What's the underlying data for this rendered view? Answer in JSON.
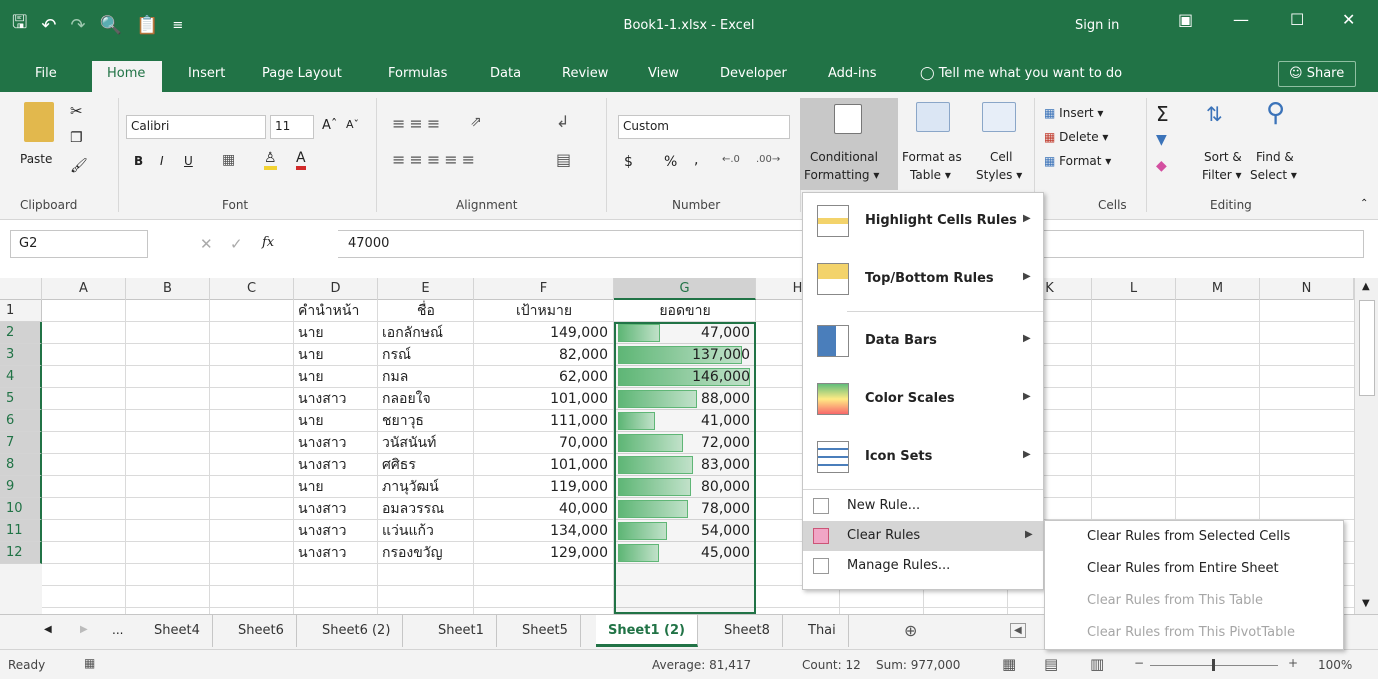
{
  "window": {
    "title": "Book1-1.xlsx - Excel",
    "sign_in": "Sign in",
    "qat_icons": [
      "save-icon",
      "undo-icon",
      "redo-icon",
      "print-preview-icon",
      "paste-icon",
      "customize-qat-icon"
    ]
  },
  "tabs": [
    "File",
    "Home",
    "Insert",
    "Page Layout",
    "Formulas",
    "Data",
    "Review",
    "View",
    "Developer",
    "Add-ins"
  ],
  "tell_me": "Tell me what you want to do",
  "share": "Share",
  "ribbon": {
    "clipboard": {
      "label": "Clipboard",
      "paste": "Paste"
    },
    "font": {
      "label": "Font",
      "name": "Calibri",
      "size": "11",
      "bold": "B",
      "italic": "I",
      "underline": "U"
    },
    "alignment": {
      "label": "Alignment"
    },
    "number": {
      "label": "Number",
      "format": "Custom",
      "currency": "$",
      "percent": "%",
      "comma": ","
    },
    "styles": {
      "conditional_1": "Conditional",
      "conditional_2": "Formatting",
      "format_table_1": "Format as",
      "format_table_2": "Table",
      "cell_styles_1": "Cell",
      "cell_styles_2": "Styles"
    },
    "cells": {
      "label": "Cells",
      "insert": "Insert",
      "delete": "Delete",
      "format": "Format"
    },
    "editing": {
      "label": "Editing",
      "sort_1": "Sort &",
      "sort_2": "Filter",
      "find_1": "Find &",
      "find_2": "Select"
    }
  },
  "formula_bar": {
    "name_box": "G2",
    "fx": "fx",
    "value": "47000"
  },
  "columns": [
    "A",
    "B",
    "C",
    "D",
    "E",
    "F",
    "G",
    "H",
    "K",
    "L",
    "M",
    "N"
  ],
  "rows": [
    "1",
    "2",
    "3",
    "4",
    "5",
    "6",
    "7",
    "8",
    "9",
    "10",
    "11",
    "12"
  ],
  "table": {
    "headers": [
      "คำนำหน้า",
      "ชื่อ",
      "เป้าหมาย",
      "ยอดขาย"
    ],
    "rows": [
      {
        "prefix": "นาย",
        "name": "เอกลักษณ์",
        "target": "149,000",
        "sales": "47,000",
        "bar": 0.32
      },
      {
        "prefix": "นาย",
        "name": "กรณ์",
        "target": "82,000",
        "sales": "137,000",
        "bar": 0.94
      },
      {
        "prefix": "นาย",
        "name": "กมล",
        "target": "62,000",
        "sales": "146,000",
        "bar": 1.0
      },
      {
        "prefix": "นางสาว",
        "name": "กลอยใจ",
        "target": "101,000",
        "sales": "88,000",
        "bar": 0.6
      },
      {
        "prefix": "นาย",
        "name": "ชยาวุธ",
        "target": "111,000",
        "sales": "41,000",
        "bar": 0.28
      },
      {
        "prefix": "นางสาว",
        "name": "วนัสนันท์",
        "target": "70,000",
        "sales": "72,000",
        "bar": 0.49
      },
      {
        "prefix": "นางสาว",
        "name": "ศศิธร",
        "target": "101,000",
        "sales": "83,000",
        "bar": 0.57
      },
      {
        "prefix": "นาย",
        "name": "ภานุวัฒน์",
        "target": "119,000",
        "sales": "80,000",
        "bar": 0.55
      },
      {
        "prefix": "นางสาว",
        "name": "อมลวรรณ",
        "target": "40,000",
        "sales": "78,000",
        "bar": 0.53
      },
      {
        "prefix": "นางสาว",
        "name": "แว่นแก้ว",
        "target": "134,000",
        "sales": "54,000",
        "bar": 0.37
      },
      {
        "prefix": "นางสาว",
        "name": "กรองขวัญ",
        "target": "129,000",
        "sales": "45,000",
        "bar": 0.31
      }
    ]
  },
  "cf_menu": {
    "highlight": "Highlight Cells Rules",
    "topbottom": "Top/Bottom Rules",
    "databars": "Data Bars",
    "colorscales": "Color Scales",
    "iconsets": "Icon Sets",
    "newrule": "New Rule...",
    "clearrules": "Clear Rules",
    "managerules": "Manage Rules..."
  },
  "clear_submenu": [
    {
      "label": "Clear Rules from Selected Cells",
      "enabled": true
    },
    {
      "label": "Clear Rules from Entire Sheet",
      "enabled": true
    },
    {
      "label": "Clear Rules from This Table",
      "enabled": false
    },
    {
      "label": "Clear Rules from This PivotTable",
      "enabled": false
    }
  ],
  "sheets": {
    "ellipsis": "...",
    "tabs": [
      "Sheet4",
      "Sheet6",
      "Sheet6 (2)",
      "Sheet1",
      "Sheet5",
      "Sheet1 (2)",
      "Sheet8",
      "Thai"
    ],
    "active": "Sheet1 (2)"
  },
  "status": {
    "ready": "Ready",
    "average": "Average: 81,417",
    "count": "Count: 12",
    "sum": "Sum: 977,000",
    "zoom": "100%"
  },
  "colors": {
    "accent": "#217346",
    "databar": "#63be7b"
  }
}
